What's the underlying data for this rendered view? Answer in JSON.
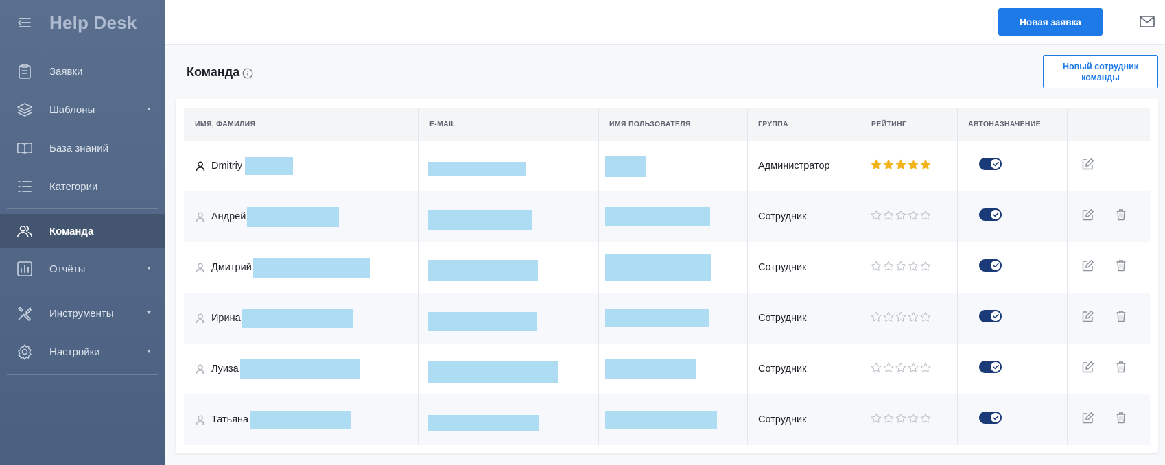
{
  "app": {
    "title": "Help Desk"
  },
  "sidebar": {
    "items": [
      {
        "label": "Заявки",
        "icon": "clipboard-icon",
        "has_submenu": false,
        "active": false
      },
      {
        "label": "Шаблоны",
        "icon": "layers-icon",
        "has_submenu": true,
        "active": false
      },
      {
        "label": "База знаний",
        "icon": "book-icon",
        "has_submenu": false,
        "active": false
      },
      {
        "label": "Категории",
        "icon": "list-icon",
        "has_submenu": false,
        "active": false
      },
      {
        "label": "Команда",
        "icon": "team-icon",
        "has_submenu": false,
        "active": true
      },
      {
        "label": "Отчёты",
        "icon": "chart-icon",
        "has_submenu": true,
        "active": false
      },
      {
        "label": "Инструменты",
        "icon": "tools-icon",
        "has_submenu": true,
        "active": false
      },
      {
        "label": "Настройки",
        "icon": "gear-icon",
        "has_submenu": true,
        "active": false
      }
    ]
  },
  "topbar": {
    "new_ticket_label": "Новая заявка",
    "mail_icon": "mail-icon"
  },
  "page": {
    "title": "Команда",
    "new_member_label": "Новый сотрудник команды"
  },
  "table": {
    "columns": [
      "ИМЯ, ФАМИЛИЯ",
      "E-MAIL",
      "ИМЯ ПОЛЬЗОВАТЕЛЯ",
      "ГРУППА",
      "РЕЙТИНГ",
      "АВТОНАЗНАЧЕНИЕ"
    ],
    "rows": [
      {
        "first_name": "Dmitriy",
        "group": "Администратор",
        "rating": 5,
        "auto_assign": true,
        "deletable": false
      },
      {
        "first_name": "Андрей",
        "group": "Сотрудник",
        "rating": 0,
        "auto_assign": true,
        "deletable": true
      },
      {
        "first_name": "Дмитрий",
        "group": "Сотрудник",
        "rating": 0,
        "auto_assign": true,
        "deletable": true
      },
      {
        "first_name": "Ирина",
        "group": "Сотрудник",
        "rating": 0,
        "auto_assign": true,
        "deletable": true
      },
      {
        "first_name": "Луиза",
        "group": "Сотрудник",
        "rating": 0,
        "auto_assign": true,
        "deletable": true
      },
      {
        "first_name": "Татьяна",
        "group": "Сотрудник",
        "rating": 0,
        "auto_assign": true,
        "deletable": true
      }
    ]
  },
  "colors": {
    "sidebar": "#526785",
    "primary": "#1d7ae6",
    "toggle": "#1b3a78",
    "star": "#f2b41c",
    "redaction": "#aedcf3"
  }
}
